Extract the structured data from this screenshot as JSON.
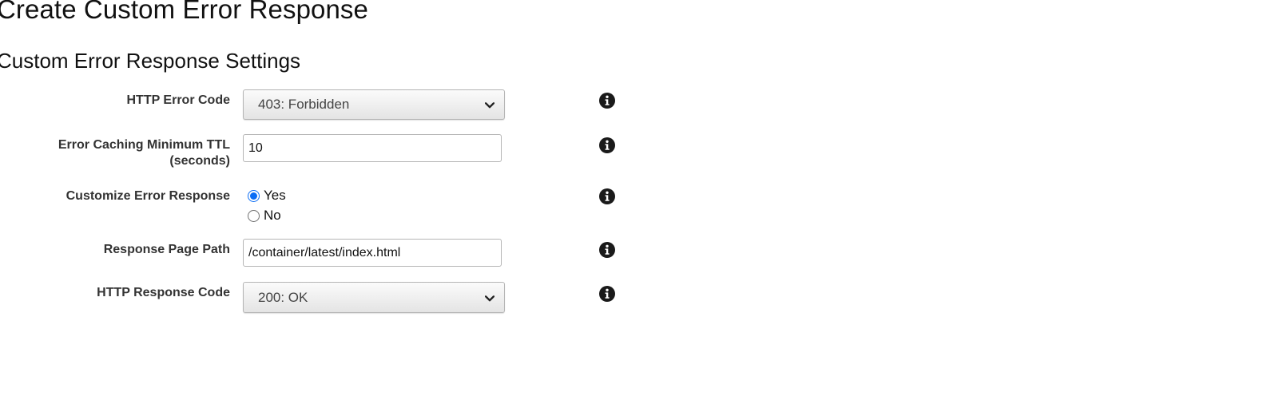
{
  "page": {
    "title": "Create Custom Error Response",
    "section_title": "Custom Error Response Settings"
  },
  "form": {
    "http_error_code": {
      "label": "HTTP Error Code",
      "value": "403: Forbidden"
    },
    "error_caching_min_ttl": {
      "label_line1": "Error Caching Minimum TTL",
      "label_line2": "(seconds)",
      "value": "10"
    },
    "customize_error_response": {
      "label": "Customize Error Response",
      "options": [
        {
          "label": "Yes",
          "selected": true
        },
        {
          "label": "No",
          "selected": false
        }
      ]
    },
    "response_page_path": {
      "label": "Response Page Path",
      "value": "/container/latest/index.html"
    },
    "http_response_code": {
      "label": "HTTP Response Code",
      "value": "200: OK"
    }
  },
  "icons": {
    "info": "info-icon",
    "dropdown": "chevron-down-icon"
  },
  "colors": {
    "radio_accent": "#0a6cf5",
    "label_text": "#333333",
    "info_icon": "#1a1a1a"
  }
}
